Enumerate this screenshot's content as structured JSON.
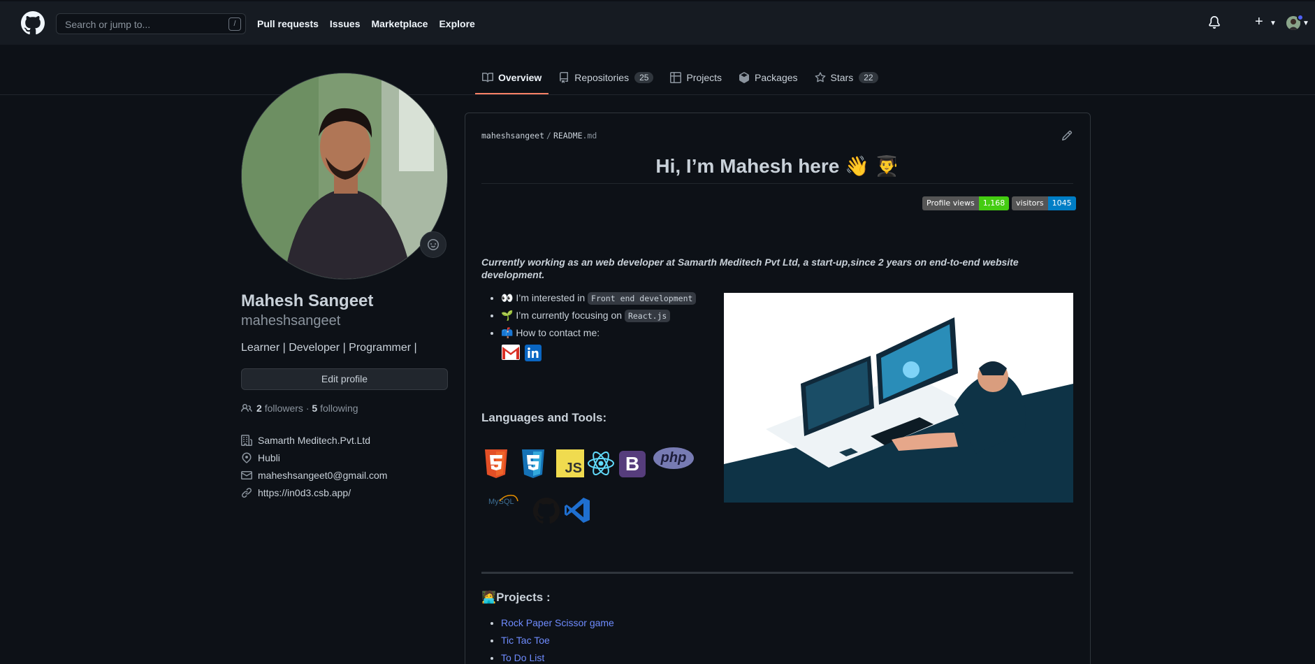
{
  "header": {
    "search_placeholder": "Search or jump to...",
    "search_shortcut": "/",
    "nav": [
      "Pull requests",
      "Issues",
      "Marketplace",
      "Explore"
    ]
  },
  "tabs": [
    {
      "label": "Overview",
      "icon": "book-icon",
      "active": true
    },
    {
      "label": "Repositories",
      "icon": "repo-icon",
      "count": "25"
    },
    {
      "label": "Projects",
      "icon": "table-icon"
    },
    {
      "label": "Packages",
      "icon": "package-icon"
    },
    {
      "label": "Stars",
      "icon": "star-icon",
      "count": "22"
    }
  ],
  "profile": {
    "fullname": "Mahesh Sangeet",
    "username": "maheshsangeet",
    "bio": "Learner | Developer | Programmer |",
    "edit_label": "Edit profile",
    "followers": "2",
    "followers_label": "followers",
    "separator": "·",
    "following": "5",
    "following_label": "following",
    "company": "Samarth Meditech.Pvt.Ltd",
    "location": "Hubli",
    "email": "maheshsangeet0@gmail.com",
    "website": "https://in0d3.csb.app/"
  },
  "readme": {
    "path_user": "maheshsangeet",
    "path_sep": "/",
    "path_file": "README",
    "path_ext": ".md",
    "title": "Hi, I’m Mahesh here 👋 👨‍🎓",
    "badge1_label": "Profile views",
    "badge1_value": "1,168",
    "badge2_label": "visitors",
    "badge2_value": "1045",
    "intro": "Currently working as an web developer at Samarth Meditech Pvt Ltd, a start-up,since 2 years on end-to-end website development.",
    "interest_prefix": "👀 I’m interested in ",
    "interest_code": "Front end development",
    "focus_prefix": "🌱 I’m currently focusing on ",
    "focus_code": "React.js",
    "contact": "📫 How to contact me:",
    "languages_title": "Languages and Tools:",
    "projects_title": "🧑‍💻Projects :",
    "projects": [
      "Rock Paper Scissor game",
      "Tic Tac Toe",
      "To Do List"
    ],
    "tech_php": "php",
    "tech_mysql": "MySQL",
    "tech_bootstrap": "B",
    "tech_js": "JS"
  },
  "colors": {
    "bg": "#0d1117",
    "header": "#161b22",
    "accent": "#f78166",
    "link": "#6f8cff",
    "badge_green": "#44cc11",
    "badge_blue": "#007ec6"
  }
}
